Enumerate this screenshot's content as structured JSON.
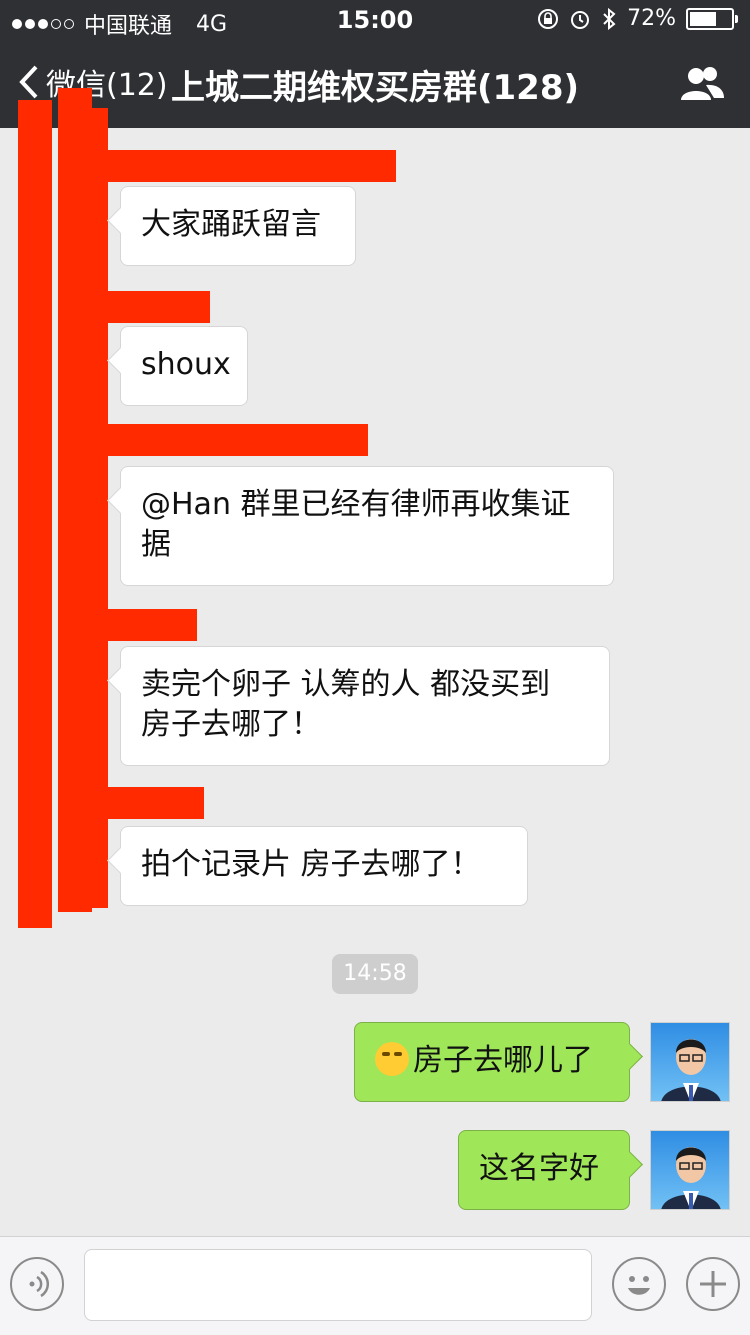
{
  "status_bar": {
    "carrier": "中国联通",
    "network": "4G",
    "time": "15:00",
    "battery_percent": "72%",
    "battery_level": 0.72,
    "signal_strength": 3,
    "signal_max": 5
  },
  "nav": {
    "back_label": "微信(12)",
    "title": "上城二期维权买房群(128)"
  },
  "messages": {
    "incoming": [
      {
        "text": "大家踊跃留言"
      },
      {
        "text": "shoux"
      },
      {
        "text": "@Han 群里已经有律师再收集证据"
      },
      {
        "text": "卖完个卵子 认筹的人 都没买到   房子去哪了！"
      },
      {
        "text": "拍个记录片 房子去哪了！"
      }
    ],
    "timestamp": "14:58",
    "outgoing": [
      {
        "text": "房子去哪儿了",
        "emoji": "laugh-cry-emoji"
      },
      {
        "text": "这名字好"
      }
    ]
  },
  "input_bar": {
    "voice_icon": "voice-icon",
    "emoji_icon": "emoji-icon",
    "plus_icon": "plus-icon",
    "text": ""
  },
  "colors": {
    "header_bg": "#2e3034",
    "chat_bg": "#ebebeb",
    "incoming_bubble": "#ffffff",
    "outgoing_bubble": "#9fe658",
    "redaction": "#ff2a00"
  }
}
